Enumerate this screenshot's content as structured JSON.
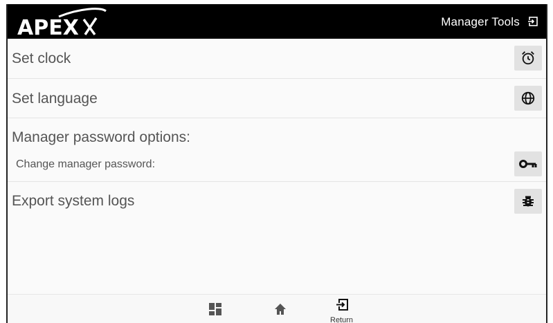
{
  "header": {
    "logo_text": "APEX",
    "title": "Manager Tools",
    "exit_icon": "exit-icon"
  },
  "menu": {
    "set_clock": {
      "label": "Set clock",
      "icon": "alarm-clock-icon"
    },
    "set_language": {
      "label": "Set language",
      "icon": "globe-icon"
    },
    "password": {
      "label": "Manager password options:",
      "sublabel": "Change manager password:",
      "icon": "key-icon"
    },
    "export_logs": {
      "label": "Export system logs",
      "icon": "bug-icon"
    }
  },
  "bottom_nav": {
    "apps_icon": "grid-icon",
    "home_icon": "home-icon",
    "return_label": "Return",
    "return_icon": "return-icon"
  },
  "colors": {
    "header_bg": "#000000",
    "button_bg": "#e2e2e2",
    "text": "#555555"
  }
}
